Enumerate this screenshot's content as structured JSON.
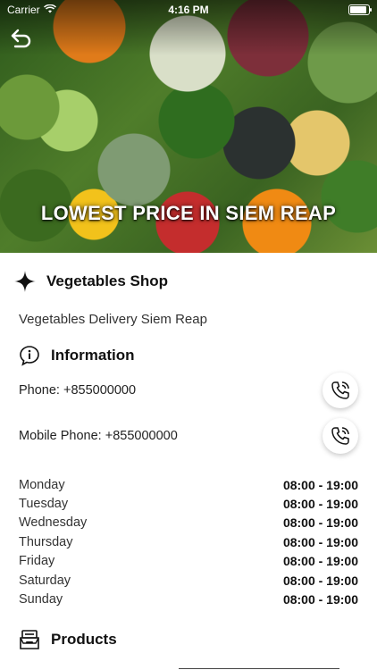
{
  "status": {
    "carrier": "Carrier",
    "time": "4:16 PM"
  },
  "hero": {
    "banner": "LOWEST PRICE IN SIEM REAP"
  },
  "shop": {
    "name": "Vegetables Shop",
    "description": "Vegetables Delivery Siem Reap"
  },
  "information": {
    "title": "Information",
    "phone": "Phone: +855000000",
    "mobile": "Mobile Phone: +855000000"
  },
  "hours": [
    {
      "day": "Monday",
      "time": "08:00 - 19:00"
    },
    {
      "day": "Tuesday",
      "time": "08:00 - 19:00"
    },
    {
      "day": "Wednesday",
      "time": "08:00 - 19:00"
    },
    {
      "day": "Thursday",
      "time": "08:00 - 19:00"
    },
    {
      "day": "Friday",
      "time": "08:00 - 19:00"
    },
    {
      "day": "Saturday",
      "time": "08:00 - 19:00"
    },
    {
      "day": "Sunday",
      "time": "08:00 - 19:00"
    }
  ],
  "products": {
    "title": "Products"
  },
  "icons": {
    "back": "back-arrow-icon",
    "sparkle": "sparkle-icon",
    "info": "info-icon",
    "phone": "phone-icon",
    "products": "products-box-icon"
  }
}
